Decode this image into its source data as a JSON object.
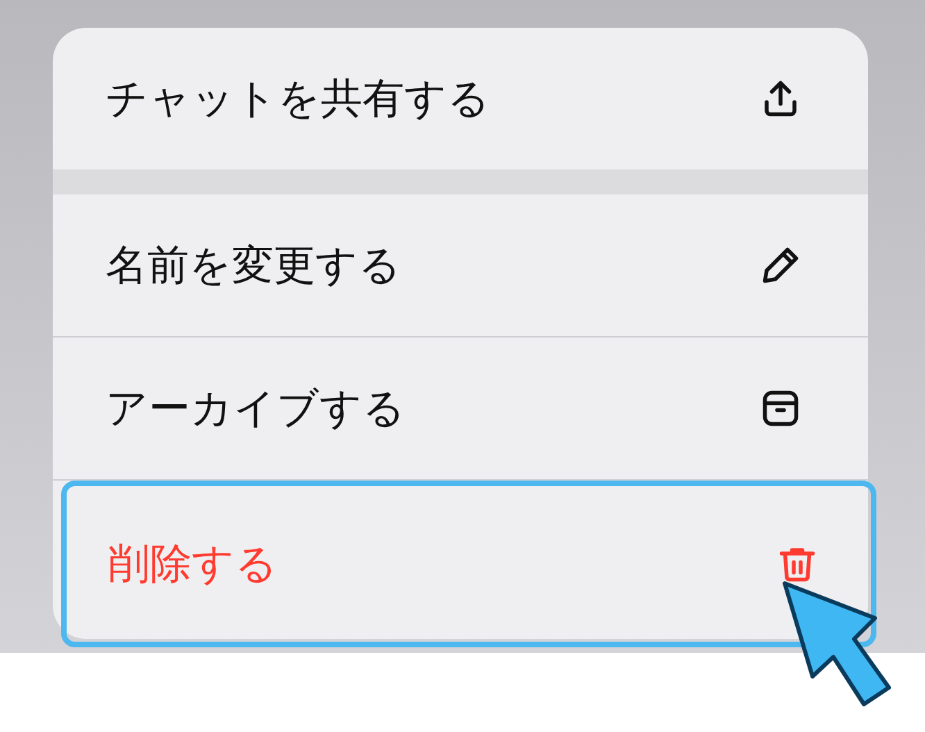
{
  "menu": {
    "sections": [
      {
        "items": [
          {
            "label": "チャットを共有する",
            "destructive": false,
            "selected": false
          }
        ]
      },
      {
        "items": [
          {
            "label": "名前を変更する",
            "destructive": false,
            "selected": false
          },
          {
            "label": "アーカイブする",
            "destructive": false,
            "selected": false
          },
          {
            "label": "削除する",
            "destructive": true,
            "selected": true
          }
        ]
      }
    ]
  }
}
